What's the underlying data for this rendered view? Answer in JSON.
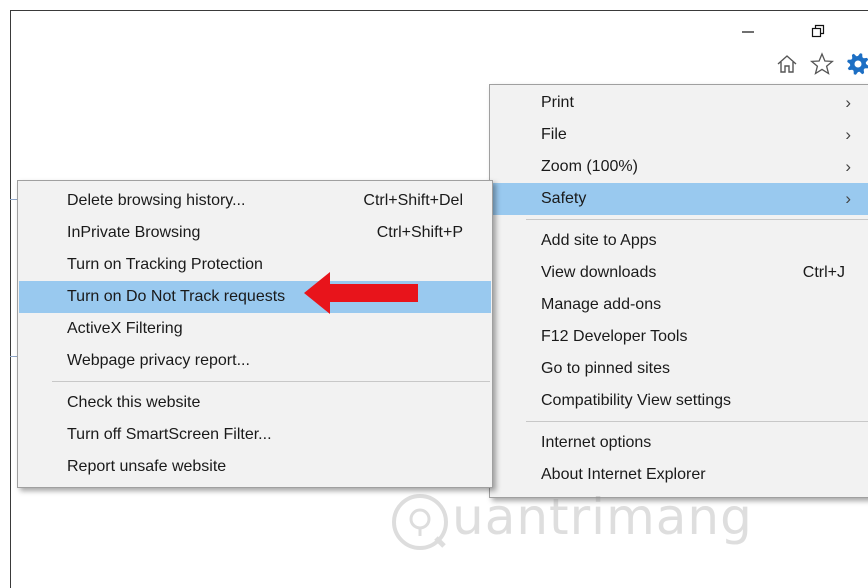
{
  "window_controls": {
    "minimize_icon": "minimize-icon",
    "restore_icon": "restore-icon"
  },
  "toolbar": {
    "home_icon": "home-icon",
    "favorites_icon": "star-icon",
    "tools_icon": "gear-icon",
    "tools_color": "#1d6fc4"
  },
  "tools_menu": {
    "groups": [
      [
        {
          "label": "Print",
          "submenu": true
        },
        {
          "label": "File",
          "submenu": true
        },
        {
          "label": "Zoom (100%)",
          "submenu": true
        },
        {
          "label": "Safety",
          "submenu": true,
          "highlighted": true
        }
      ],
      [
        {
          "label": "Add site to Apps"
        },
        {
          "label": "View downloads",
          "shortcut": "Ctrl+J"
        },
        {
          "label": "Manage add-ons"
        },
        {
          "label": "F12 Developer Tools"
        },
        {
          "label": "Go to pinned sites"
        },
        {
          "label": "Compatibility View settings"
        }
      ],
      [
        {
          "label": "Internet options"
        },
        {
          "label": "About Internet Explorer"
        }
      ]
    ]
  },
  "safety_submenu": {
    "groups": [
      [
        {
          "label": "Delete browsing history...",
          "shortcut": "Ctrl+Shift+Del"
        },
        {
          "label": "InPrivate Browsing",
          "shortcut": "Ctrl+Shift+P"
        },
        {
          "label": "Turn on Tracking Protection"
        },
        {
          "label": "Turn on Do Not Track requests",
          "highlighted": true
        },
        {
          "label": "ActiveX Filtering"
        },
        {
          "label": "Webpage privacy report..."
        }
      ],
      [
        {
          "label": "Check this website"
        },
        {
          "label": "Turn off SmartScreen Filter..."
        },
        {
          "label": "Report unsafe website"
        }
      ]
    ]
  },
  "annotation": {
    "arrow_color": "#e8141b"
  },
  "watermark": {
    "text": "uantrimang"
  },
  "colors": {
    "highlight": "#99c9ef",
    "menu_background": "#f2f2f2"
  }
}
